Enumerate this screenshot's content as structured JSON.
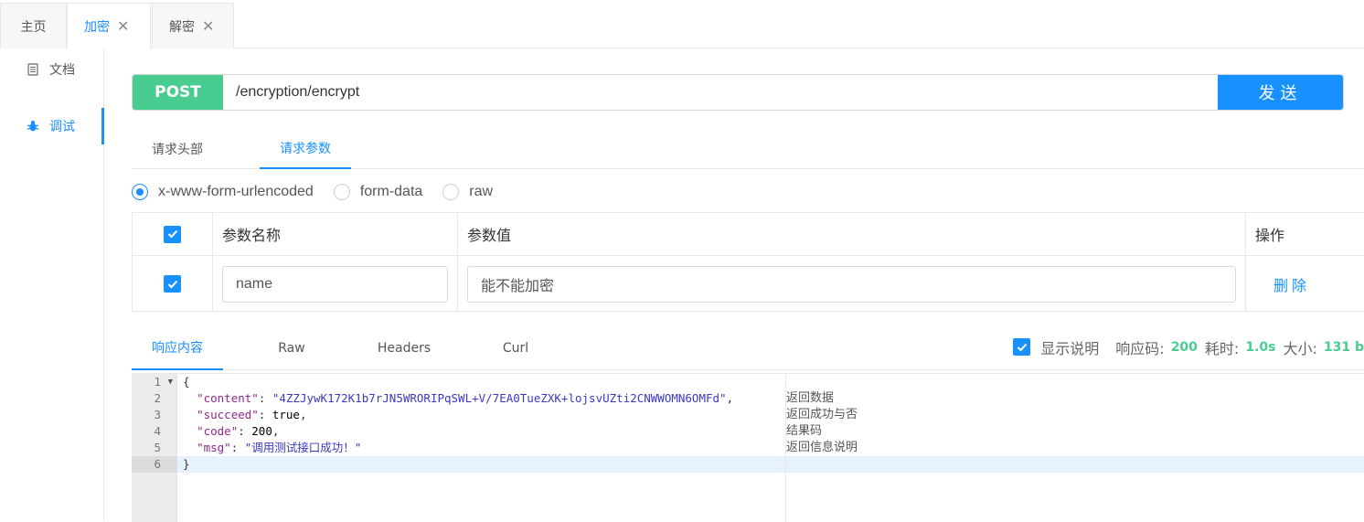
{
  "tabs": [
    {
      "label": "主页",
      "active": false,
      "closable": false
    },
    {
      "label": "加密",
      "active": true,
      "closable": true
    },
    {
      "label": "解密",
      "active": false,
      "closable": true
    }
  ],
  "sidebar": {
    "items": [
      {
        "label": "文档",
        "icon": "document-icon",
        "active": false
      },
      {
        "label": "调试",
        "icon": "bug-icon",
        "active": true
      }
    ]
  },
  "request": {
    "method": "POST",
    "url": "/encryption/encrypt",
    "send_label": "发送",
    "colors": {
      "method_bg": "#49cc90",
      "send_bg": "#1890ff"
    }
  },
  "request_tabs": [
    {
      "label": "请求头部",
      "active": false
    },
    {
      "label": "请求参数",
      "active": true
    }
  ],
  "body_types": [
    {
      "label": "x-www-form-urlencoded",
      "checked": true
    },
    {
      "label": "form-data",
      "checked": false
    },
    {
      "label": "raw",
      "checked": false
    }
  ],
  "params_table": {
    "headers": [
      "参数名称",
      "参数值",
      "操作"
    ],
    "rows": [
      {
        "checked": true,
        "name": "name",
        "value": "能不能加密",
        "action": "删除"
      }
    ]
  },
  "response_tabs": [
    {
      "label": "响应内容",
      "active": true
    },
    {
      "label": "Raw",
      "active": false
    },
    {
      "label": "Headers",
      "active": false
    },
    {
      "label": "Curl",
      "active": false
    }
  ],
  "response_info": {
    "show_desc_label": "显示说明",
    "show_desc_checked": true,
    "code_label": "响应码:",
    "code": "200",
    "time_label": "耗时:",
    "time": "1.0s",
    "size_label": "大小:",
    "size": "131 b"
  },
  "response_body": {
    "line_numbers": [
      "1",
      "2",
      "3",
      "4",
      "5",
      "6"
    ],
    "content_key": "\"content\"",
    "content_value": "\"4ZZJywK172K1b7rJN5WRORIPqSWL+V/7EA0TueZXK+lojsvUZti2CNWWOMN6OMFd\"",
    "succeed_key": "\"succeed\"",
    "succeed_value": "true",
    "code_key": "\"code\"",
    "code_value": "200",
    "msg_key": "\"msg\"",
    "msg_value": "\"调用测试接口成功！\"",
    "notes": [
      "返回数据",
      "返回成功与否",
      "结果码",
      "返回信息说明"
    ]
  }
}
